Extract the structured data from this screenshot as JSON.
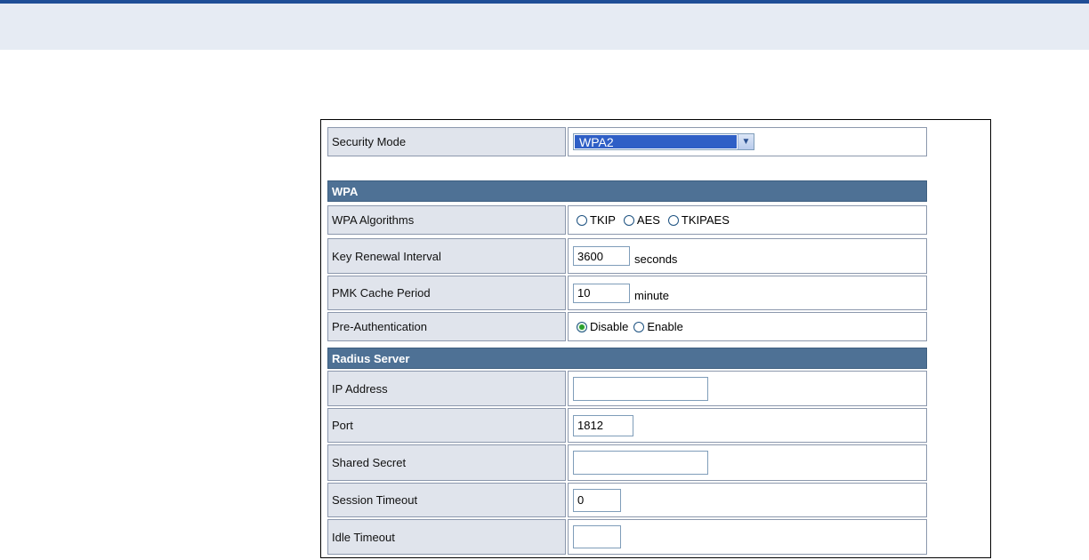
{
  "security_mode": {
    "label": "Security Mode",
    "value": "WPA2"
  },
  "wpa": {
    "title": "WPA",
    "algorithms": {
      "label": "WPA Algorithms",
      "options": [
        "TKIP",
        "AES",
        "TKIPAES"
      ],
      "selected": null
    },
    "key_renewal": {
      "label": "Key Renewal Interval",
      "value": "3600",
      "unit": "seconds"
    },
    "pmk_cache": {
      "label": "PMK Cache Period",
      "value": "10",
      "unit": "minute"
    },
    "pre_auth": {
      "label": "Pre-Authentication",
      "options": [
        "Disable",
        "Enable"
      ],
      "selected": "Disable"
    }
  },
  "radius": {
    "title": "Radius Server",
    "ip_address": {
      "label": "IP Address",
      "value": ""
    },
    "port": {
      "label": "Port",
      "value": "1812"
    },
    "shared_secret": {
      "label": "Shared Secret",
      "value": ""
    },
    "session_timeout": {
      "label": "Session Timeout",
      "value": "0"
    },
    "idle_timeout": {
      "label": "Idle Timeout",
      "value": ""
    }
  },
  "colors": {
    "header_band": "#e6ebf3",
    "top_rule": "#1f4e96",
    "section_bar": "#4e7195",
    "label_cell": "#e0e4ec",
    "radio_selected": "#2aa12a"
  },
  "icons": {
    "select_arrow": "chevron-down-icon",
    "radio": "radio-button-icon"
  }
}
